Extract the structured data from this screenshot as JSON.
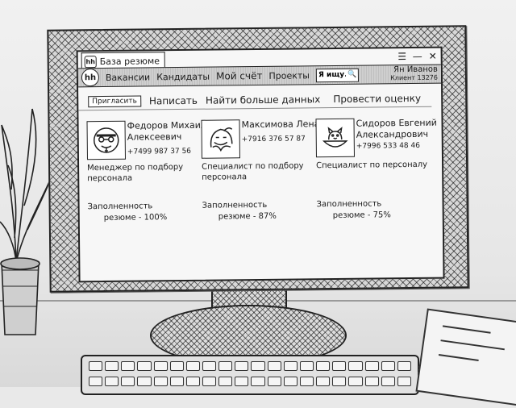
{
  "window": {
    "tab_title": "База резюме",
    "tab_icon": "hh",
    "controls": [
      "☰",
      "—",
      "✕"
    ]
  },
  "navbar": {
    "logo": "hh",
    "links": [
      "Вакансии",
      "Кандидаты",
      "Мой счёт",
      "Проекты"
    ],
    "search": {
      "value": "Я ищу...",
      "icon": "search-icon"
    },
    "user": {
      "name": "Ян Иванов",
      "subtitle": "Клиент 13276"
    }
  },
  "actions": {
    "invite": "Пригласить",
    "write": "Написать",
    "find_more": "Найти больше данных",
    "assess": "Провести оценку"
  },
  "candidates": [
    {
      "name": "Федоров Михаил Алексеевич",
      "phone": "+7499 987 37 56",
      "role": "Менеджер по подбору персонала",
      "fill_line1": "Заполненность",
      "fill_line2": "резюме - 100%",
      "avatar": "person-with-glasses-icon"
    },
    {
      "name": "Максимова Лена",
      "phone": "+7916 376 57 87",
      "role": "Специалист по подбору персонала",
      "fill_line1": "Заполненность",
      "fill_line2": "резюме - 87%",
      "avatar": "woman-avatar-icon"
    },
    {
      "name": "Сидоров Евгений Александрович",
      "phone": "+7996 533 48 46",
      "role": "Специалист по персоналу",
      "fill_line1": "Заполненность",
      "fill_line2": "резюме - 75%",
      "avatar": "cat-in-bowl-icon"
    }
  ]
}
